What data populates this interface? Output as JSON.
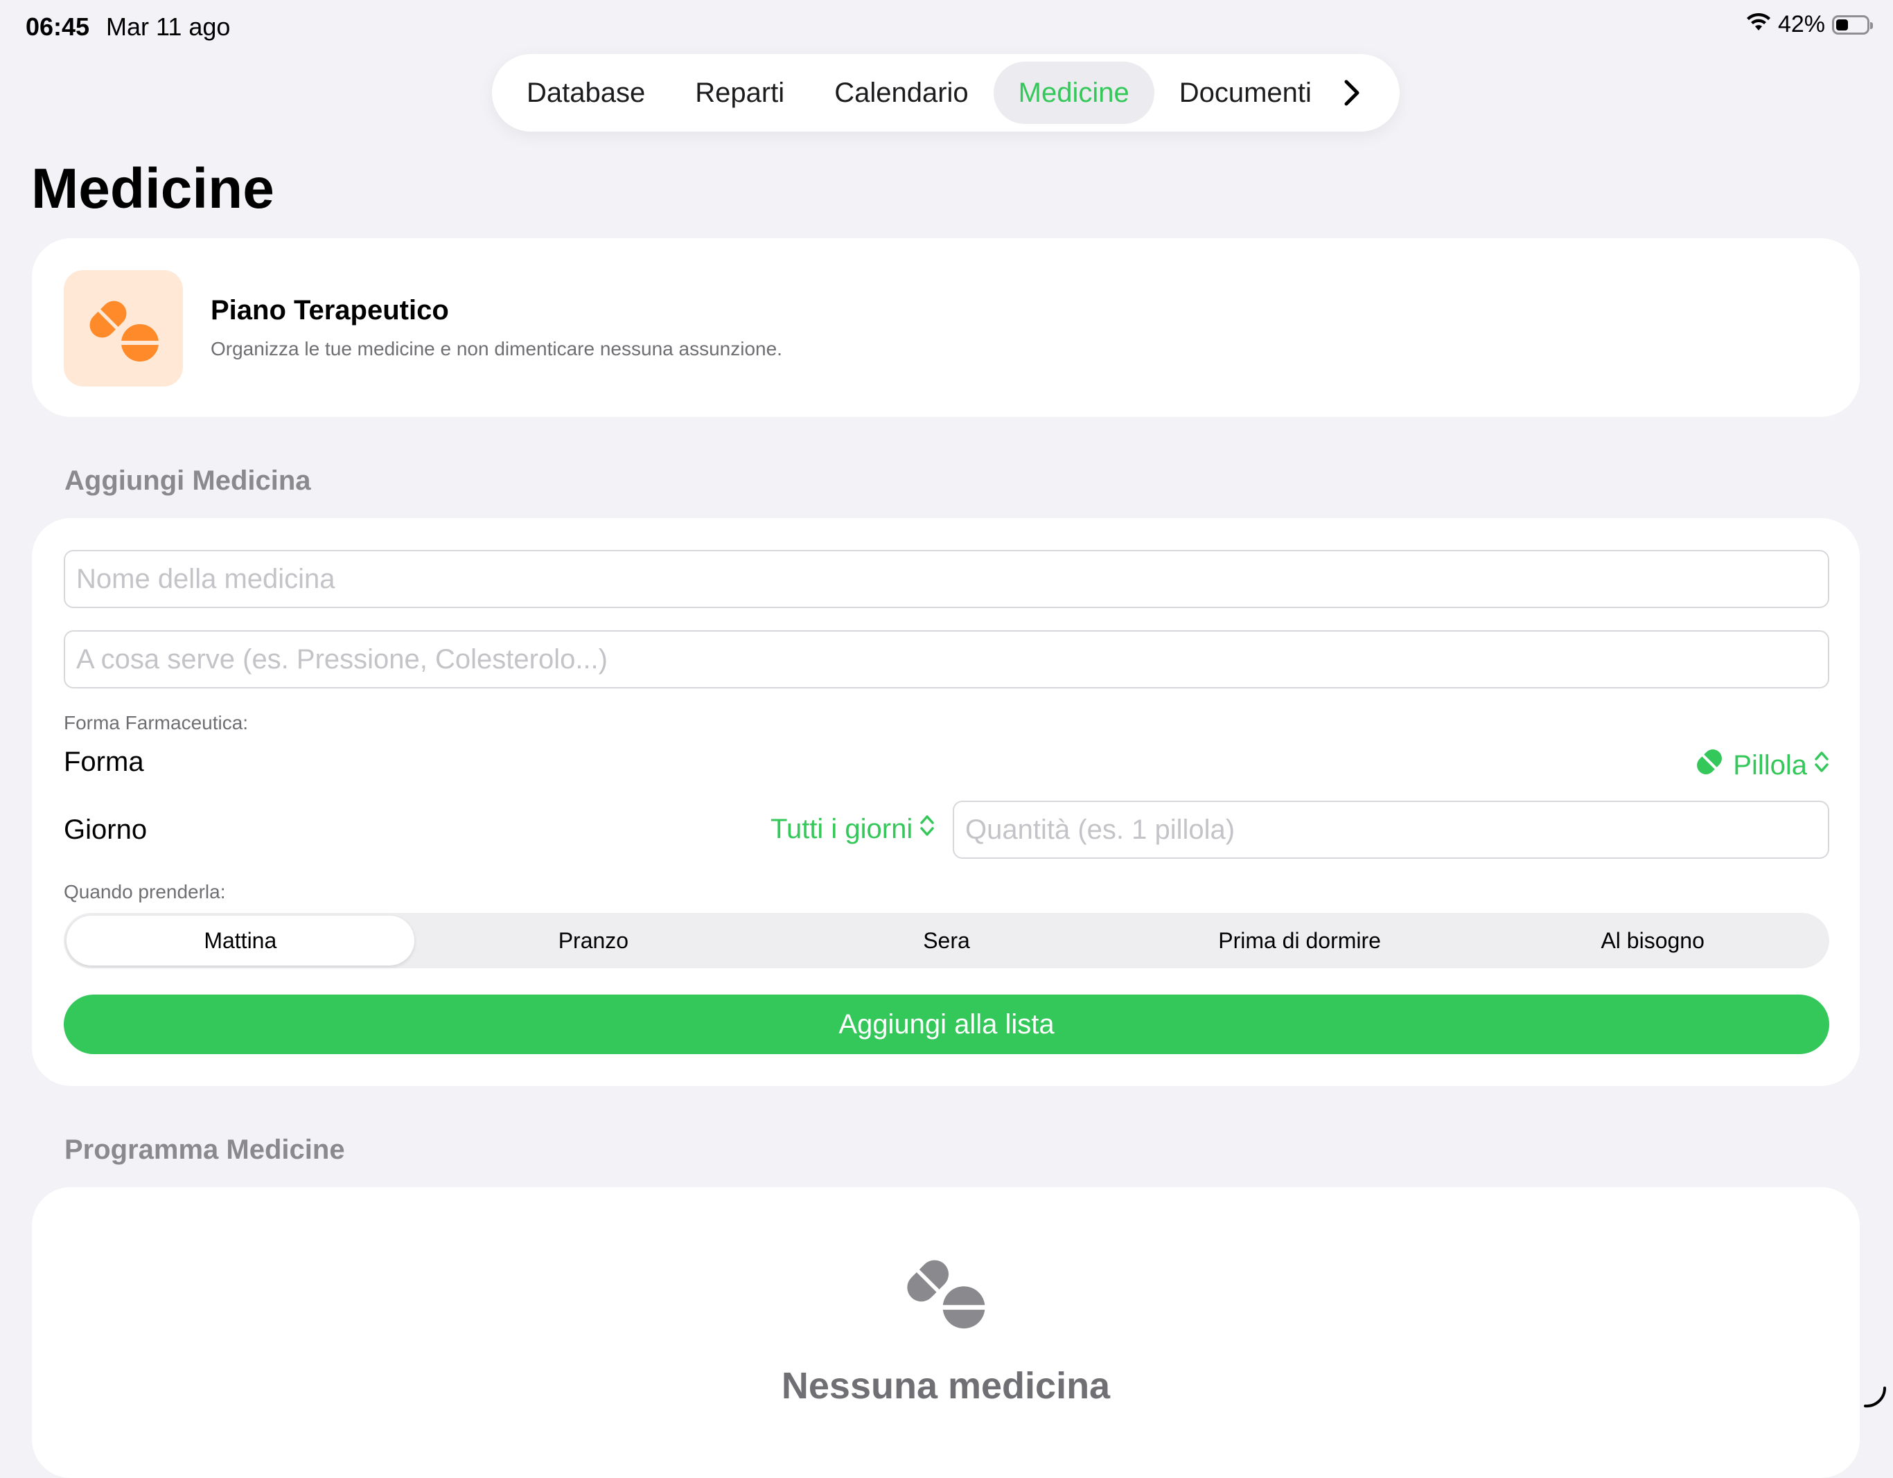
{
  "status_bar": {
    "time": "06:45",
    "date": "Mar 11 ago",
    "battery": "42%"
  },
  "tabs": [
    {
      "label": "Database"
    },
    {
      "label": "Reparti"
    },
    {
      "label": "Calendario"
    },
    {
      "label": "Medicine",
      "active": true
    },
    {
      "label": "Documenti"
    }
  ],
  "page": {
    "title": "Medicine"
  },
  "hero": {
    "title": "Piano Terapeutico",
    "subtitle": "Organizza le tue medicine e non dimenticare nessuna assunzione.",
    "icon": "pills-icon"
  },
  "add_section": {
    "header": "Aggiungi Medicina",
    "name_placeholder": "Nome della medicina",
    "purpose_placeholder": "A cosa serve (es. Pressione, Colesterolo...)",
    "form_caption": "Forma Farmaceutica:",
    "form_label": "Forma",
    "form_value": "Pillola",
    "day_label": "Giorno",
    "day_value": "Tutti i giorni",
    "quantity_placeholder": "Quantità (es. 1 pillola)",
    "when_caption": "Quando prenderla:",
    "times": [
      {
        "label": "Mattina",
        "selected": true
      },
      {
        "label": "Pranzo"
      },
      {
        "label": "Sera"
      },
      {
        "label": "Prima di dormire"
      },
      {
        "label": "Al bisogno"
      }
    ],
    "submit_label": "Aggiungi alla lista"
  },
  "schedule_section": {
    "header": "Programma Medicine",
    "empty_title": "Nessuna medicina"
  },
  "colors": {
    "accent": "#34c759",
    "hero_icon": "#ff8a2a",
    "hero_icon_bg": "#ffe8d6",
    "background": "#f2f2f7"
  }
}
